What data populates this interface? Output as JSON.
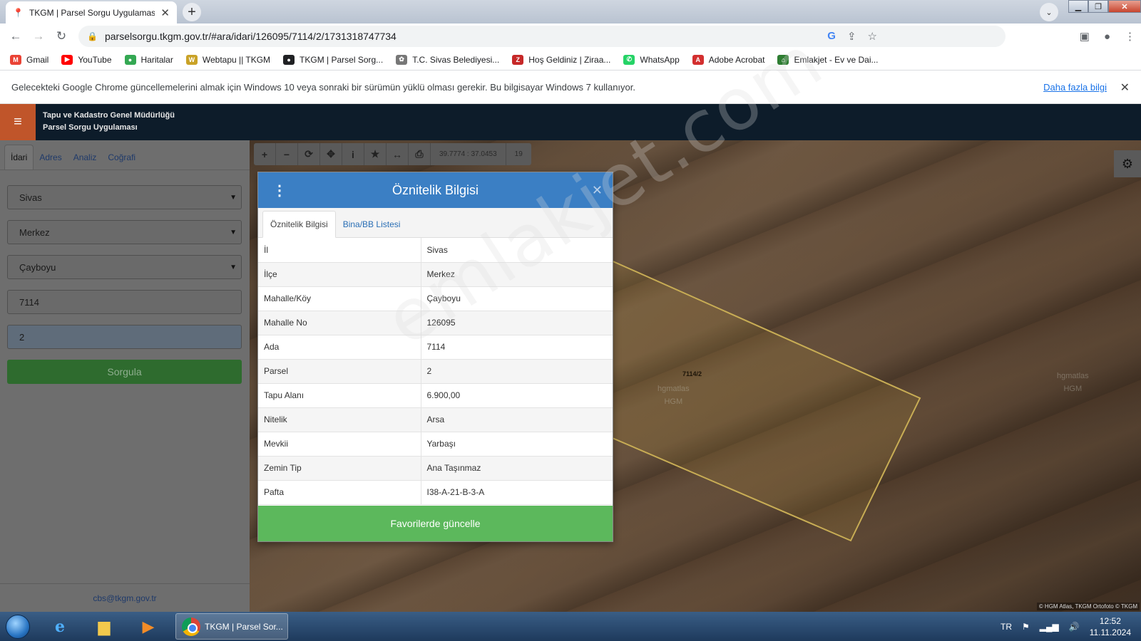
{
  "browser": {
    "tab_title": "TKGM | Parsel Sorgu Uygulaması",
    "url": "parselsorgu.tkgm.gov.tr/#ara/idari/126095/7114/2/1731318747734",
    "bookmarks": [
      {
        "label": "Gmail",
        "color": "#ea4335",
        "glyph": "M"
      },
      {
        "label": "YouTube",
        "color": "#ff0000",
        "glyph": "▶"
      },
      {
        "label": "Haritalar",
        "color": "#34a853",
        "glyph": "●"
      },
      {
        "label": "Webtapu || TKGM",
        "color": "#c9a227",
        "glyph": "W"
      },
      {
        "label": "TKGM | Parsel Sorg...",
        "color": "#202124",
        "glyph": "●"
      },
      {
        "label": "T.C. Sivas Belediyesi...",
        "color": "#777777",
        "glyph": "✿"
      },
      {
        "label": "Hoş Geldiniz | Ziraa...",
        "color": "#c62828",
        "glyph": "Z"
      },
      {
        "label": "WhatsApp",
        "color": "#25d366",
        "glyph": "✆"
      },
      {
        "label": "Adobe Acrobat",
        "color": "#d32f2f",
        "glyph": "A"
      },
      {
        "label": "Emlakjet - Ev ve Dai...",
        "color": "#2e7d32",
        "glyph": "⌂"
      }
    ],
    "infobar_text": "Gelecekteki Google Chrome güncellemelerini almak için Windows 10 veya sonraki bir sürümün yüklü olması gerekir. Bu bilgisayar Windows 7 kullanıyor.",
    "infobar_link": "Daha fazla bilgi"
  },
  "app": {
    "title_line1": "Tapu ve Kadastro Genel Müdürlüğü",
    "title_line2": "Parsel Sorgu Uygulaması",
    "tabs": [
      "İdari",
      "Adres",
      "Analiz",
      "Coğrafi"
    ],
    "fields": {
      "il": "Sivas",
      "ilce": "Merkez",
      "mahalle": "Çayboyu",
      "ada": "7114",
      "parsel": "2"
    },
    "query_button": "Sorgula",
    "footer_email": "cbs@tkgm.gov.tr"
  },
  "map": {
    "coords": "39.7774 : 37.0453",
    "zoom": "19",
    "parcel_label": "7114/2",
    "hgm_watermark": "HGM",
    "hgm_watermark_prefix": "hgmatlas",
    "attribution": "© HGM Atlas, TKGM Ortofoto © TKGM",
    "site_watermark": "emlakjet.com"
  },
  "modal": {
    "title": "Öznitelik Bilgisi",
    "tabs": [
      "Öznitelik Bilgisi",
      "Bina/BB Listesi"
    ],
    "rows": [
      {
        "key": "İl",
        "value": "Sivas"
      },
      {
        "key": "İlçe",
        "value": "Merkez"
      },
      {
        "key": "Mahalle/Köy",
        "value": "Çayboyu"
      },
      {
        "key": "Mahalle No",
        "value": "126095"
      },
      {
        "key": "Ada",
        "value": "7114"
      },
      {
        "key": "Parsel",
        "value": "2"
      },
      {
        "key": "Tapu Alanı",
        "value": "6.900,00"
      },
      {
        "key": "Nitelik",
        "value": "Arsa"
      },
      {
        "key": "Mevkii",
        "value": "Yarbaşı"
      },
      {
        "key": "Zemin Tip",
        "value": "Ana Taşınmaz"
      },
      {
        "key": "Pafta",
        "value": "I38-A-21-B-3-A"
      }
    ],
    "action_button": "Favorilerde güncelle"
  },
  "taskbar": {
    "active_app": "TKGM | Parsel Sor...",
    "lang": "TR",
    "time": "12:52",
    "date": "11.11.2024"
  }
}
